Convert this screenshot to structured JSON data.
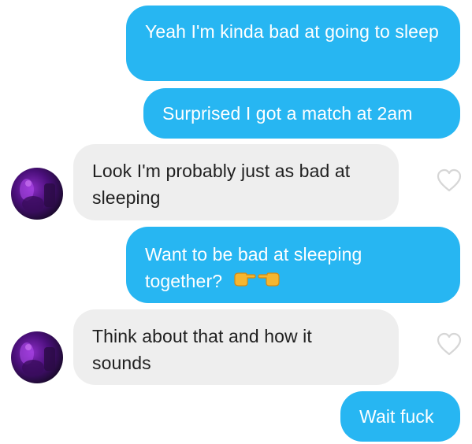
{
  "messages": [
    {
      "id": 1,
      "direction": "outgoing",
      "text": "Yeah I'm kinda bad at going to sleep"
    },
    {
      "id": 2,
      "direction": "outgoing",
      "text": "Surprised I got a match at 2am"
    },
    {
      "id": 3,
      "direction": "incoming",
      "text": "Look I'm probably just as bad at sleeping",
      "avatar": "profile-photo",
      "like_icon": "heart-outline-icon"
    },
    {
      "id": 4,
      "direction": "outgoing",
      "text": "Want to be bad at sleeping together?",
      "emoji": [
        "👉",
        "👈"
      ]
    },
    {
      "id": 5,
      "direction": "incoming",
      "text": "Think about that and how it sounds",
      "avatar": "profile-photo",
      "like_icon": "heart-outline-icon"
    },
    {
      "id": 6,
      "direction": "outgoing",
      "text": "Wait fuck"
    }
  ],
  "colors": {
    "outgoing_bubble": "#27B6F2",
    "incoming_bubble": "#EEEEEE",
    "outgoing_text": "#FFFFFF",
    "incoming_text": "#1F1F1F",
    "heart_outline": "#D6D6D6"
  }
}
